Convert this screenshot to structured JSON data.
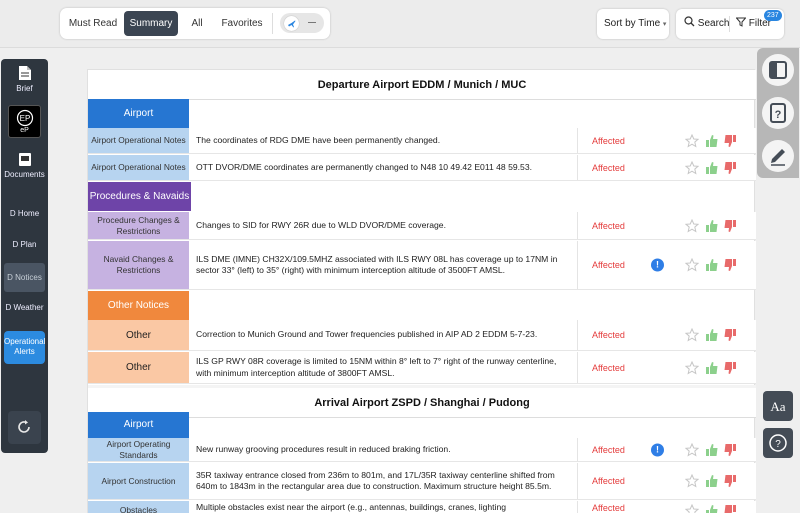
{
  "toolbar": {
    "filters": [
      "Must Read",
      "Summary",
      "All",
      "Favorites"
    ],
    "active_filter": "Summary",
    "sort_label": "Sort by Time",
    "search_label": "Search",
    "filter_label": "Filter",
    "filter_badge": "237"
  },
  "sidebar": {
    "items": [
      {
        "label": "Brief"
      },
      {
        "label": "eP"
      },
      {
        "label": "Documents"
      },
      {
        "label": "D Home"
      },
      {
        "label": "D Plan"
      },
      {
        "label": "D Notices"
      },
      {
        "label": "D Weather"
      },
      {
        "label": "Operational Alerts"
      }
    ]
  },
  "departure": {
    "title": "Departure Airport EDDM / Munich / MUC",
    "categories": {
      "airport": "Airport",
      "procedures": "Procedures & Navaids",
      "other": "Other Notices"
    },
    "rows": [
      {
        "type": "Airport Operational Notes",
        "text": "The coordinates of RDG DME have been permanently changed.",
        "status": "Affected"
      },
      {
        "type": "Airport Operational Notes",
        "text": "OTT DVOR/DME coordinates are permanently changed to N48 10 49.42 E011 48 59.53.",
        "status": "Affected"
      },
      {
        "type": "Procedure Changes & Restrictions",
        "text": "Changes to SID for RWY 26R due to WLD DVOR/DME coverage.",
        "status": "Affected"
      },
      {
        "type": "Navaid Changes & Restrictions",
        "text": "ILS DME (IMNE) CH32X/109.5MHZ associated with ILS RWY 08L has coverage up to 17NM in sector 33° (left) to 35° (right) with minimum interception altitude of 3500FT AMSL.",
        "status": "Affected"
      },
      {
        "type": "Other",
        "text": "Correction to Munich Ground and Tower frequencies published in AIP AD 2 EDDM 5-7-23.",
        "status": "Affected"
      },
      {
        "type": "Other",
        "text": "ILS GP RWY 08R coverage is limited to 15NM within 8° left to 7° right of the runway centerline, with minimum interception altitude of 3800FT AMSL.",
        "status": "Affected"
      }
    ]
  },
  "arrival": {
    "title": "Arrival Airport ZSPD / Shanghai / Pudong",
    "categories": {
      "airport": "Airport"
    },
    "rows": [
      {
        "type": "Airport Operating Standards",
        "text": "New runway grooving procedures result in reduced braking friction.",
        "status": "Affected"
      },
      {
        "type": "Airport Construction",
        "text": "35R taxiway entrance closed from 236m to 801m, and 17L/35R taxiway centerline shifted from 640m to 1843m in the rectangular area due to construction. Maximum structure height 85.5m.",
        "status": "Affected"
      },
      {
        "type": "Obstacles",
        "text": "Multiple obstacles exist near the airport (e.g., antennas, buildings, cranes, lighting",
        "status": "Affected"
      }
    ]
  },
  "info_mark": "!",
  "colors": {
    "airport": "#2676d2",
    "procedures": "#6e44a8",
    "other": "#f0883d",
    "affected": "#e43c3c",
    "thumb_up": "#8cd08c",
    "thumb_down": "#e86a6a"
  }
}
